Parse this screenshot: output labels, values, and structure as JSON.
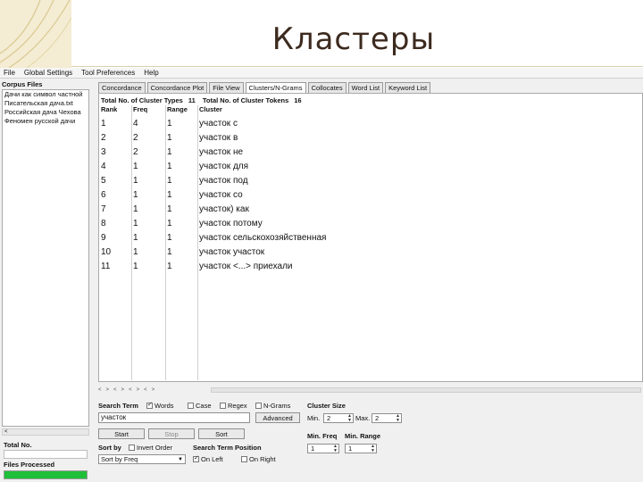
{
  "slide": {
    "title": "Кластеры"
  },
  "menu": [
    "File",
    "Global Settings",
    "Tool Preferences",
    "Help"
  ],
  "corpus": {
    "header": "Corpus Files",
    "files": [
      "Дачи как символ частной",
      "Писательская дача.txt",
      "Российская дача Чехова",
      "Феномен русской дачи"
    ]
  },
  "tabs": [
    "Concordance",
    "Concordance Plot",
    "File View",
    "Clusters/N-Grams",
    "Collocates",
    "Word List",
    "Keyword List"
  ],
  "active_tab": "Clusters/N-Grams",
  "stats": {
    "types_label": "Total No. of Cluster Types",
    "types_value": "11",
    "tokens_label": "Total No. of Cluster Tokens",
    "tokens_value": "16"
  },
  "columns": {
    "rank": "Rank",
    "freq": "Freq",
    "range": "Range",
    "cluster": "Cluster"
  },
  "rows": [
    {
      "rank": "1",
      "freq": "4",
      "range": "1",
      "cluster": "участок с"
    },
    {
      "rank": "2",
      "freq": "2",
      "range": "1",
      "cluster": "участок в"
    },
    {
      "rank": "3",
      "freq": "2",
      "range": "1",
      "cluster": "участок не"
    },
    {
      "rank": "4",
      "freq": "1",
      "range": "1",
      "cluster": "участок для"
    },
    {
      "rank": "5",
      "freq": "1",
      "range": "1",
      "cluster": "участок под"
    },
    {
      "rank": "6",
      "freq": "1",
      "range": "1",
      "cluster": "участок со"
    },
    {
      "rank": "7",
      "freq": "1",
      "range": "1",
      "cluster": "участок) как"
    },
    {
      "rank": "8",
      "freq": "1",
      "range": "1",
      "cluster": "участок потому"
    },
    {
      "rank": "9",
      "freq": "1",
      "range": "1",
      "cluster": "участок сельскохозяйственная"
    },
    {
      "rank": "10",
      "freq": "1",
      "range": "1",
      "cluster": "участок участок"
    },
    {
      "rank": "11",
      "freq": "1",
      "range": "1",
      "cluster": "участок <...> приехали"
    }
  ],
  "left_scroll": "<",
  "totals": {
    "total_label": "Total No.",
    "processed_label": "Files Processed",
    "progress": 1.0
  },
  "scrollbar_glyphs": [
    "<",
    ">",
    "<",
    ">",
    "<",
    ">",
    "<",
    ">"
  ],
  "search": {
    "term_label": "Search Term",
    "opt_words": "Words",
    "opt_case": "Case",
    "opt_regex": "Regex",
    "opt_ngrams": "N-Grams",
    "value": "участок",
    "advanced": "Advanced",
    "start": "Start",
    "stop": "Stop",
    "sort": "Sort",
    "sort_by_label": "Sort by",
    "invert_order": "Invert Order",
    "sort_value": "Sort by Freq",
    "position_label": "Search Term Position",
    "on_left": "On Left",
    "on_right": "On Right"
  },
  "cluster_size": {
    "label": "Cluster Size",
    "min_label": "Min.",
    "min": "2",
    "max_label": "Max.",
    "max": "2"
  },
  "min_freq": {
    "label": "Min. Freq",
    "value": "1"
  },
  "min_range": {
    "label": "Min. Range",
    "value": "1"
  }
}
